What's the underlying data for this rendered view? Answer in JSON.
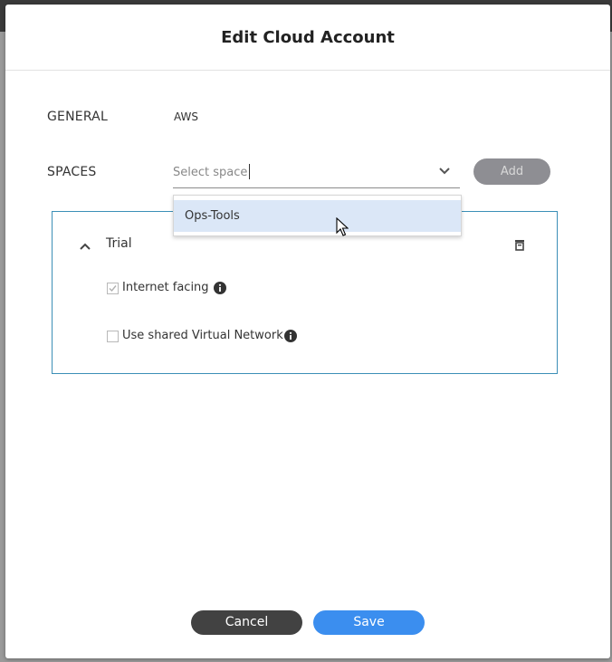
{
  "modal": {
    "title": "Edit Cloud Account"
  },
  "general": {
    "label": "GENERAL",
    "value": "AWS"
  },
  "spaces": {
    "label": "SPACES",
    "select_placeholder": "Select space",
    "add_label": "Add",
    "dropdown_options": [
      "Ops-Tools"
    ]
  },
  "space_panel": {
    "title": "Trial",
    "options": [
      {
        "label": "Internet facing",
        "checked": true,
        "disabled": true
      },
      {
        "label": "Use shared Virtual Network",
        "checked": false,
        "disabled": false
      }
    ]
  },
  "footer": {
    "cancel_label": "Cancel",
    "save_label": "Save"
  },
  "colors": {
    "accent": "#3b8eef",
    "panel_border": "#3c8fb7",
    "highlight": "#dbe7f7"
  },
  "icons": [
    "chevron-down-icon",
    "chevron-up-icon",
    "trash-icon",
    "info-icon",
    "mouse-cursor-icon"
  ]
}
